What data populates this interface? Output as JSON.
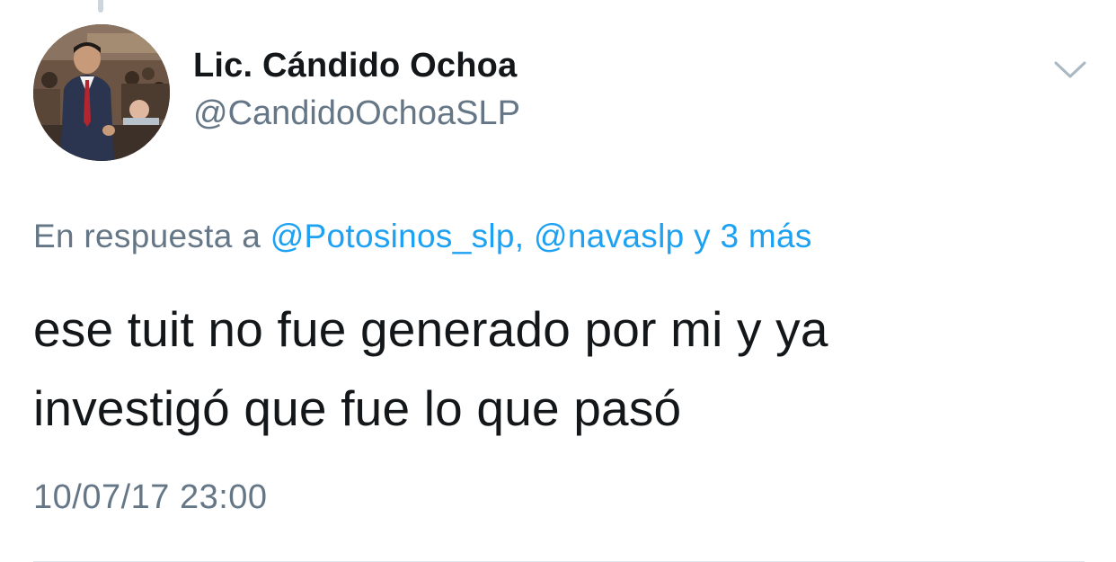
{
  "author": {
    "display_name": "Lic. Cándido Ochoa",
    "handle": "@CandidoOchoaSLP"
  },
  "reply": {
    "prefix": "En respuesta a",
    "mention_1": "@Potosinos_slp,",
    "mention_2": "@navaslp",
    "more": "y 3 más"
  },
  "tweet": {
    "line_1": "ese tuit no fue generado por mi y ya",
    "line_2": "investigó que fue lo que pasó"
  },
  "timestamp": "10/07/17 23:00",
  "icons": {
    "menu": "chevron-down-icon"
  },
  "colors": {
    "link": "#1da1f2",
    "secondary_text": "#657786",
    "primary_text": "#14171a",
    "divider": "#e1e8ed"
  }
}
